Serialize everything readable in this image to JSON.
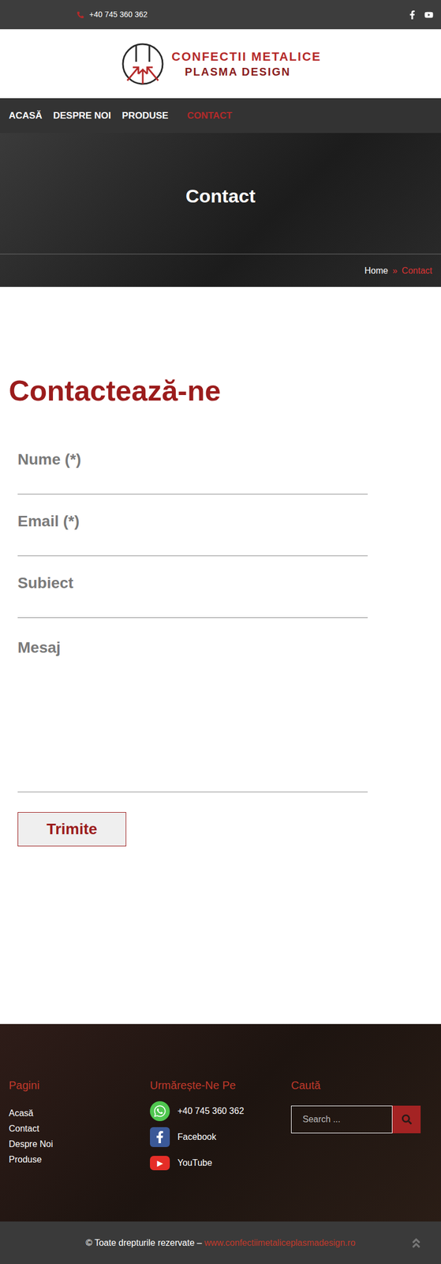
{
  "topbar": {
    "phone": "+40 745 360 362"
  },
  "logo": {
    "line1": "CONFECTII METALICE",
    "line2": "PLASMA DESIGN"
  },
  "nav": [
    {
      "label": "ACASĂ",
      "selected": false
    },
    {
      "label": "DESPRE NOI",
      "selected": false
    },
    {
      "label": "PRODUSE",
      "selected": false
    },
    {
      "label": "CONTACT",
      "selected": true
    }
  ],
  "hero": {
    "title": "Contact",
    "breadcrumb": {
      "home": "Home",
      "separator": "»",
      "current": "Contact"
    }
  },
  "form": {
    "heading": "Contactează-ne",
    "fields": [
      {
        "label": "Nume (*)",
        "kind": "input"
      },
      {
        "label": "Email (*)",
        "kind": "input"
      },
      {
        "label": "Subiect",
        "kind": "input"
      },
      {
        "label": "Mesaj",
        "kind": "textarea"
      }
    ],
    "button": "Trimite"
  },
  "footer": {
    "pages": {
      "title": "Pagini",
      "links": [
        "Acasă",
        "Contact",
        "Despre Noi",
        "Produse"
      ]
    },
    "social": {
      "title": "Urmărește-Ne Pe",
      "items": [
        {
          "label": "+40 745 360 362",
          "kind": "whatsapp"
        },
        {
          "label": "Facebook",
          "kind": "facebook"
        },
        {
          "label": "YouTube",
          "kind": "youtube"
        }
      ]
    },
    "search": {
      "title": "Caută",
      "placeholder": "Search ..."
    }
  },
  "copyright": {
    "text": "© Toate drepturile rezervate –",
    "url": "www.confectiimetaliceplasmadesign.ro"
  }
}
